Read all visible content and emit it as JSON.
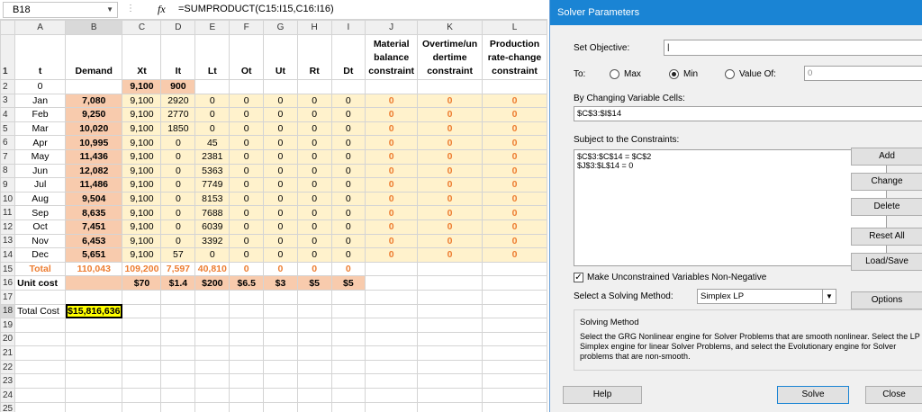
{
  "formula_bar": {
    "cell_ref": "B18",
    "fx": "fx",
    "formula": "=SUMPRODUCT(C15:I15,C16:I16)"
  },
  "columns": [
    "A",
    "B",
    "C",
    "D",
    "E",
    "F",
    "G",
    "H",
    "I",
    "J",
    "K",
    "L"
  ],
  "header_row": {
    "num": "1",
    "A": "t",
    "B": "Demand",
    "C": "Xt",
    "D": "It",
    "E": "Lt",
    "F": "Ot",
    "G": "Ut",
    "H": "Rt",
    "I": "Dt",
    "J": [
      "Material",
      "balance",
      "constraint"
    ],
    "K": [
      "Overtime/un",
      "dertime",
      "constraint"
    ],
    "L": [
      "Production",
      "rate-change",
      "constraint"
    ]
  },
  "rows": [
    {
      "num": "2",
      "A": "0",
      "B": "",
      "C": "9,100",
      "D": "900",
      "E": "",
      "F": "",
      "G": "",
      "H": "",
      "I": "",
      "J": "",
      "K": "",
      "L": ""
    },
    {
      "num": "3",
      "A": "Jan",
      "B": "7,080",
      "C": "9,100",
      "D": "2920",
      "E": "0",
      "F": "0",
      "G": "0",
      "H": "0",
      "I": "0",
      "J": "0",
      "K": "0",
      "L": "0"
    },
    {
      "num": "4",
      "A": "Feb",
      "B": "9,250",
      "C": "9,100",
      "D": "2770",
      "E": "0",
      "F": "0",
      "G": "0",
      "H": "0",
      "I": "0",
      "J": "0",
      "K": "0",
      "L": "0"
    },
    {
      "num": "5",
      "A": "Mar",
      "B": "10,020",
      "C": "9,100",
      "D": "1850",
      "E": "0",
      "F": "0",
      "G": "0",
      "H": "0",
      "I": "0",
      "J": "0",
      "K": "0",
      "L": "0"
    },
    {
      "num": "6",
      "A": "Apr",
      "B": "10,995",
      "C": "9,100",
      "D": "0",
      "E": "45",
      "F": "0",
      "G": "0",
      "H": "0",
      "I": "0",
      "J": "0",
      "K": "0",
      "L": "0"
    },
    {
      "num": "7",
      "A": "May",
      "B": "11,436",
      "C": "9,100",
      "D": "0",
      "E": "2381",
      "F": "0",
      "G": "0",
      "H": "0",
      "I": "0",
      "J": "0",
      "K": "0",
      "L": "0"
    },
    {
      "num": "8",
      "A": "Jun",
      "B": "12,082",
      "C": "9,100",
      "D": "0",
      "E": "5363",
      "F": "0",
      "G": "0",
      "H": "0",
      "I": "0",
      "J": "0",
      "K": "0",
      "L": "0"
    },
    {
      "num": "9",
      "A": "Jul",
      "B": "11,486",
      "C": "9,100",
      "D": "0",
      "E": "7749",
      "F": "0",
      "G": "0",
      "H": "0",
      "I": "0",
      "J": "0",
      "K": "0",
      "L": "0"
    },
    {
      "num": "10",
      "A": "Aug",
      "B": "9,504",
      "C": "9,100",
      "D": "0",
      "E": "8153",
      "F": "0",
      "G": "0",
      "H": "0",
      "I": "0",
      "J": "0",
      "K": "0",
      "L": "0"
    },
    {
      "num": "11",
      "A": "Sep",
      "B": "8,635",
      "C": "9,100",
      "D": "0",
      "E": "7688",
      "F": "0",
      "G": "0",
      "H": "0",
      "I": "0",
      "J": "0",
      "K": "0",
      "L": "0"
    },
    {
      "num": "12",
      "A": "Oct",
      "B": "7,451",
      "C": "9,100",
      "D": "0",
      "E": "6039",
      "F": "0",
      "G": "0",
      "H": "0",
      "I": "0",
      "J": "0",
      "K": "0",
      "L": "0"
    },
    {
      "num": "13",
      "A": "Nov",
      "B": "6,453",
      "C": "9,100",
      "D": "0",
      "E": "3392",
      "F": "0",
      "G": "0",
      "H": "0",
      "I": "0",
      "J": "0",
      "K": "0",
      "L": "0"
    },
    {
      "num": "14",
      "A": "Dec",
      "B": "5,651",
      "C": "9,100",
      "D": "57",
      "E": "0",
      "F": "0",
      "G": "0",
      "H": "0",
      "I": "0",
      "J": "0",
      "K": "0",
      "L": "0"
    }
  ],
  "total_row": {
    "num": "15",
    "A": "Total",
    "B": "110,043",
    "C": "109,200",
    "D": "7,597",
    "E": "40,810",
    "F": "0",
    "G": "0",
    "H": "0",
    "I": "0"
  },
  "unit_cost_row": {
    "num": "16",
    "A": "Unit cost",
    "B": "",
    "C": "$70",
    "D": "$1.4",
    "E": "$200",
    "F": "$6.5",
    "G": "$3",
    "H": "$5",
    "I": "$5"
  },
  "total_cost_row": {
    "num": "18",
    "label": "Total Cost",
    "value": "$15,816,636"
  },
  "empty_rows": [
    "17",
    "19",
    "20",
    "21",
    "22",
    "23",
    "24",
    "25"
  ],
  "solver": {
    "title": "Solver Parameters",
    "set_objective_label": "Set Objective:",
    "objective_value": "",
    "to_label": "To:",
    "max_label": "Max",
    "min_label": "Min",
    "value_of_label": "Value Of:",
    "value_of_value": "0",
    "selected": "Min",
    "changing_label": "By Changing Variable Cells:",
    "changing_value": "$C$3:$I$14",
    "constraints_label": "Subject to the Constraints:",
    "constraints": [
      "$C$3:$C$14 = $C$2",
      "$J$3:$L$14 = 0"
    ],
    "buttons": {
      "add": "Add",
      "change": "Change",
      "delete": "Delete",
      "reset": "Reset All",
      "load": "Load/Save"
    },
    "unconstrained_label": "Make Unconstrained Variables Non-Negative",
    "unconstrained_checked": true,
    "method_label": "Select a Solving Method:",
    "method_value": "Simplex LP",
    "options_label": "Options",
    "solving_method_title": "Solving Method",
    "solving_method_desc": "Select the GRG Nonlinear engine for Solver Problems that are smooth nonlinear. Select the LP Simplex engine for linear Solver Problems, and select the Evolutionary engine for Solver problems that are non-smooth.",
    "help_label": "Help",
    "solve_label": "Solve",
    "close_label": "Close"
  }
}
